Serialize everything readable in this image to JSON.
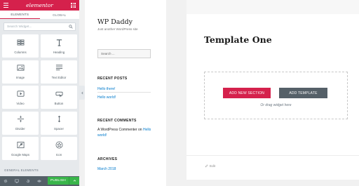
{
  "panel": {
    "brand": "elementor",
    "tabs": [
      {
        "label": "ELEMENTS"
      },
      {
        "label": "GLOBAL"
      }
    ],
    "search_placeholder": "Search Widget...",
    "widgets": [
      {
        "label": "Columns",
        "icon": "columns-icon"
      },
      {
        "label": "Heading",
        "icon": "heading-icon"
      },
      {
        "label": "Image",
        "icon": "image-icon"
      },
      {
        "label": "Text Editor",
        "icon": "text-editor-icon"
      },
      {
        "label": "Video",
        "icon": "video-icon"
      },
      {
        "label": "Button",
        "icon": "button-icon"
      },
      {
        "label": "Divider",
        "icon": "divider-icon"
      },
      {
        "label": "Spacer",
        "icon": "spacer-icon"
      },
      {
        "label": "Google Maps",
        "icon": "map-icon"
      },
      {
        "label": "Icon",
        "icon": "star-icon"
      }
    ],
    "section_title": "GENERAL ELEMENTS",
    "publish_label": "PUBLISH"
  },
  "site": {
    "title": "WP Daddy",
    "tagline": "Just another WordPress site",
    "search_placeholder": "Search ...",
    "recent_posts": {
      "title": "RECENT POSTS",
      "items": [
        "Hello there!",
        "Hello world!"
      ]
    },
    "recent_comments": {
      "title": "RECENT COMMENTS",
      "author": "A WordPress Commenter",
      "on": "on",
      "post": "Hello world!"
    },
    "archives": {
      "title": "ARCHIVES",
      "items": [
        "March 2018"
      ]
    }
  },
  "content": {
    "page_title": "Template One",
    "add_section_label": "ADD NEW SECTION",
    "add_template_label": "ADD TEMPLATE",
    "drag_hint": "Or drag widget here",
    "edit_label": "Edit"
  },
  "colors": {
    "brand": "#d5214c",
    "panel_bg": "#e6e9ec",
    "footer_bg": "#556068",
    "publish": "#39b54a",
    "link": "#007acc"
  }
}
